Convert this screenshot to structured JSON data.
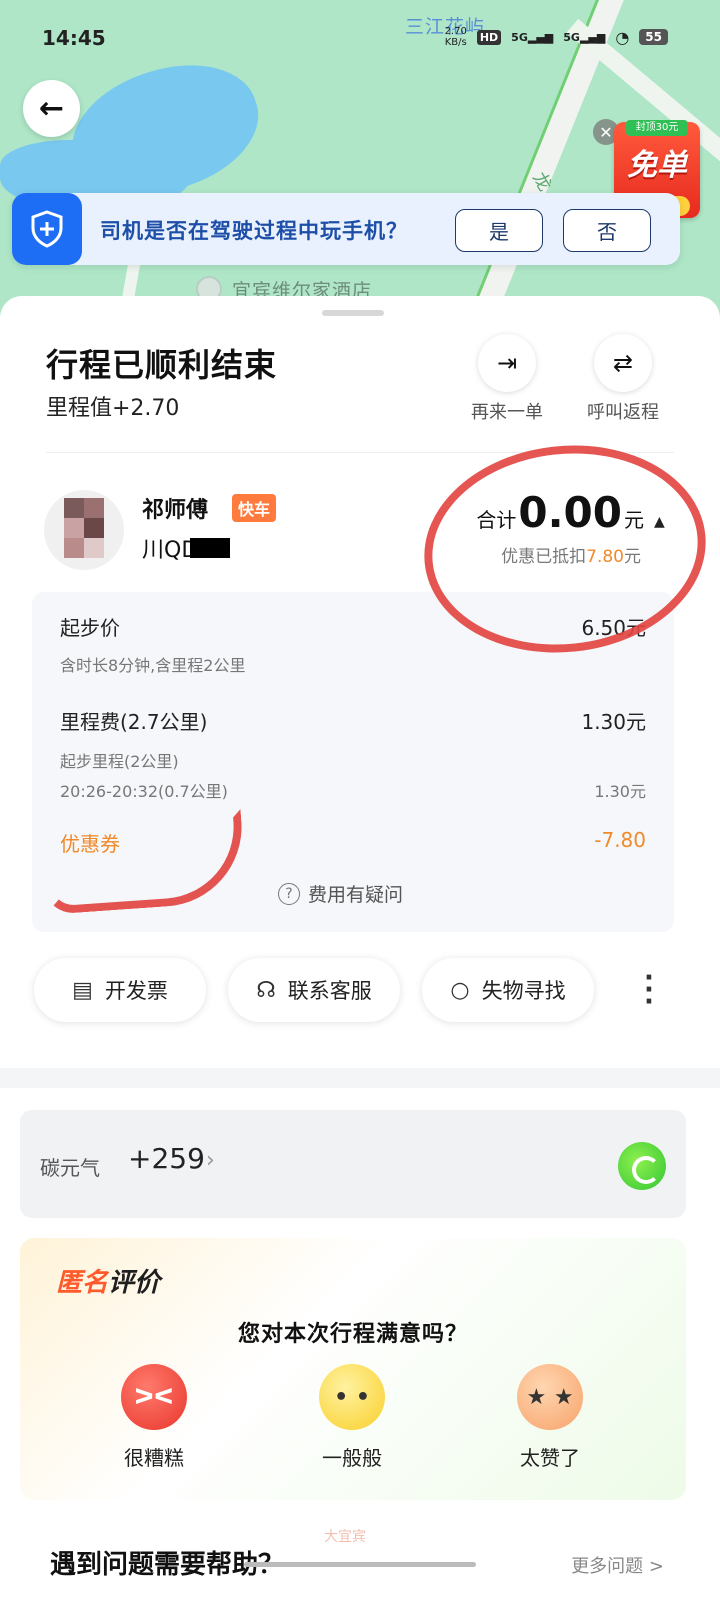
{
  "status_bar": {
    "time": "14:45",
    "speed": "2.70",
    "speed_unit": "KB/s",
    "network": "HD",
    "signal1": "5G",
    "signal2": "5G",
    "battery": "55"
  },
  "map": {
    "place_top": "三江花屿",
    "place_bottom": "宜宾维尔家酒店",
    "road_label": "龙"
  },
  "promo": {
    "cap": "封顶30元",
    "main": "免单",
    "button": "点我抢"
  },
  "safety": {
    "question": "司机是否在驾驶过程中玩手机？",
    "yes": "是",
    "no": "否"
  },
  "trip": {
    "title": "行程已顺利结束",
    "mileage": "里程值+2.70",
    "again": "再来一单",
    "return": "呼叫返程"
  },
  "driver": {
    "name": "祁师傅",
    "tag": "快车",
    "plate": "川QD"
  },
  "total": {
    "prefix": "合计",
    "amount": "0.00",
    "unit": "元",
    "discount_prefix": "优惠已抵扣",
    "discount_amount": "7.80",
    "discount_unit": "元"
  },
  "fare": {
    "base_label": "起步价",
    "base_value": "6.50元",
    "base_sub": "含时长8分钟,含里程2公里",
    "mileage_label": "里程费(2.7公里)",
    "mileage_value": "1.30元",
    "mileage_sub1": "起步里程(2公里)",
    "mileage_sub2": "20:26-20:32(0.7公里)",
    "mileage_sub2_value": "1.30元",
    "coupon_label": "优惠券",
    "coupon_value": "-7.80",
    "question": "费用有疑问"
  },
  "actions": {
    "invoice": "开发票",
    "service": "联系客服",
    "lost": "失物寻找"
  },
  "carbon": {
    "label": "碳元气",
    "value": "+259"
  },
  "rating": {
    "anon_a": "匿名",
    "anon_b": "评价",
    "question": "您对本次行程满意吗？",
    "bad": "很糟糕",
    "ok": "一般般",
    "great": "太赞了"
  },
  "help": {
    "title": "遇到问题需要帮助？",
    "more": "更多问题 >"
  },
  "watermark": "大宜宾",
  "colors": {
    "accent_blue": "#1e6ef5",
    "orange": "#f08a2a",
    "annotation_red": "#e2433f"
  }
}
